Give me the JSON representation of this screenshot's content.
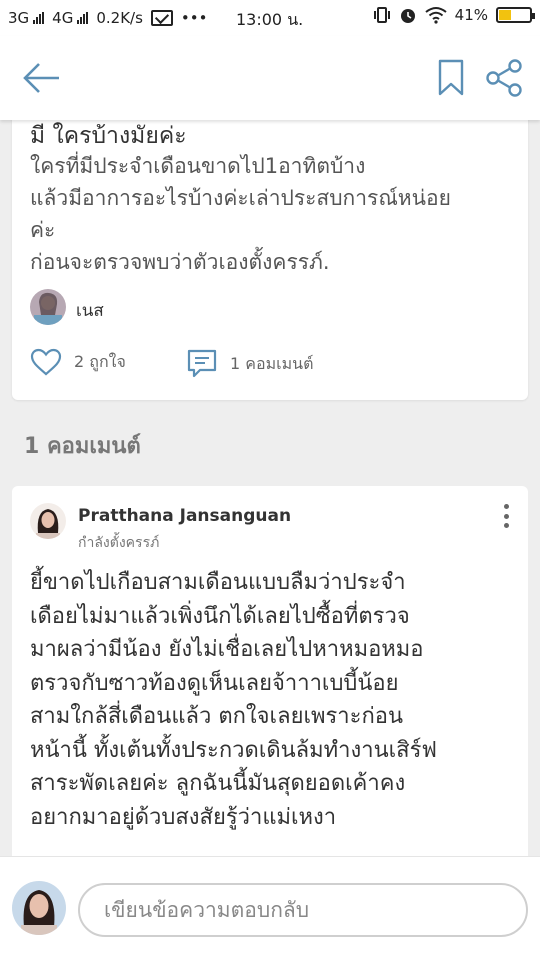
{
  "status_bar": {
    "network_1": "3G",
    "network_2": "4G",
    "speed": "0.2K/s",
    "dots": "•••",
    "time": "13:00 น.",
    "battery_percent": "41%",
    "battery_level": 0.41,
    "icons": [
      "signal-icon",
      "mail-icon",
      "vibrate-icon",
      "alarm-icon",
      "wifi-icon",
      "battery-icon"
    ]
  },
  "app_bar": {
    "icons": [
      "back-arrow-icon",
      "bookmark-icon",
      "share-icon"
    ]
  },
  "post": {
    "title": "มี ใครบ้างมัยค่ะ",
    "body_lines": [
      "ใครที่มีประจำเดือนขาดไป1อาทิตบ้าง",
      "แล้วมีอาการอะไรบ้างค่ะเล่าประสบการณ์หน่อย",
      "ค่ะ",
      "ก่อนจะตรวจพบว่าตัวเองตั้งครรภ์."
    ],
    "author": "เนส",
    "likes_label": "2 ถูกใจ",
    "comments_label": "1 คอมเมนต์"
  },
  "comments_section": {
    "heading": "1 คอมเมนต์"
  },
  "comment": {
    "name": "Pratthana Jansanguan",
    "status": "กำลังตั้งครรภ์",
    "body_lines": [
      "ยี้ขาดไปเกือบสามเดือนแบบลืมว่าประจำ",
      "เดือยไม่มาแล้วเพิ่งนึกได้เลยไปซื้อที่ตรวจ",
      "มาผลว่ามีน้อง ยังไม่เชื่อเลยไปหาหมอหมอ",
      "ตรวจกับซาวท้องดูเห็นเลยจ้าาาเบบี้น้อย",
      "สามใกล้สี่เดือนแล้ว ตกใจเลยเพราะก่อน",
      "หน้านี้ ทั้งเต้นทั้งประกวดเดินล้มทำงานเสิร์ฟ",
      "สาระพัดเลยค่ะ ลูกฉันนี้มันสุดยอดเค้าคง",
      "อยากมาอยู่ด้วบสงสัยรู้ว่าแม่เหงา"
    ]
  },
  "reply_bar": {
    "placeholder": "เขียนข้อความตอบกลับ"
  },
  "colors": {
    "icon_blue": "#5b8fb5",
    "background": "#eeeeee",
    "card": "#ffffff",
    "battery_fill": "#f2c20f"
  }
}
